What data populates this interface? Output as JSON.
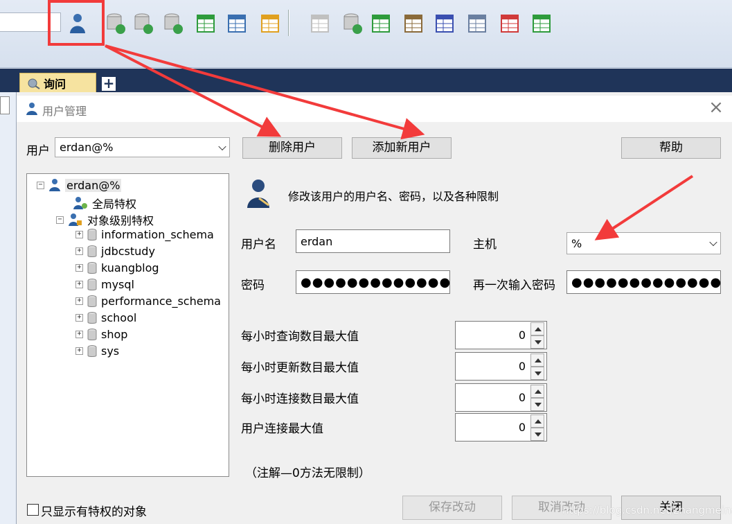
{
  "toolbar": {
    "icons": [
      "user-manager-icon",
      "db-add-icon",
      "db-export-icon",
      "db-import-icon",
      "table-green-icon",
      "table-blue-icon",
      "table-yellow-icon",
      "wrench-icon",
      "db-sync-icon",
      "schema-compare-icon",
      "db-migrate-icon",
      "scheduler-icon",
      "keyboard-icon",
      "table-red-icon",
      "schema-designer-icon"
    ]
  },
  "tabs": {
    "query_label": "询问",
    "add_label": "+"
  },
  "dialog": {
    "title": "用户管理",
    "close_symbol": "×",
    "user_label": "用户",
    "user_value": "erdan@%",
    "delete_user": "删除用户",
    "add_user": "添加新用户",
    "help": "帮助",
    "description": "修改该用户的用户名、密码，以及各种限制",
    "username_label": "用户名",
    "username_value": "erdan",
    "host_label": "主机",
    "host_value": "%",
    "password_label": "密码",
    "password_value": "●●●●●●●●●●●●●",
    "password_confirm_label": "再一次输入密码",
    "password_confirm_value": "●●●●●●●●●●●●●",
    "limits": [
      {
        "label": "每小时查询数目最大值",
        "value": "0"
      },
      {
        "label": "每小时更新数目最大值",
        "value": "0"
      },
      {
        "label": "每小时连接数目最大值",
        "value": "0"
      },
      {
        "label": "用户连接最大值",
        "value": "0"
      }
    ],
    "note": "（注解—0方法无限制）",
    "show_privileged_only": "只显示有特权的对象",
    "save": "保存改动",
    "cancel": "取消改动",
    "close": "关闭"
  },
  "tree": {
    "root": "erdan@%",
    "global": "全局特权",
    "object_level": "对象级别特权",
    "databases": [
      "information_schema",
      "jdbcstudy",
      "kuangblog",
      "mysql",
      "performance_schema",
      "school",
      "shop",
      "sys"
    ],
    "expand_minus": "−",
    "expand_plus": "+"
  },
  "watermark": "https://blog.csdn.net/zhangmeina",
  "colors": {
    "accent_red": "#f23b3b",
    "tab_bar": "#1f3459",
    "tab_active": "#f6e3a0"
  }
}
